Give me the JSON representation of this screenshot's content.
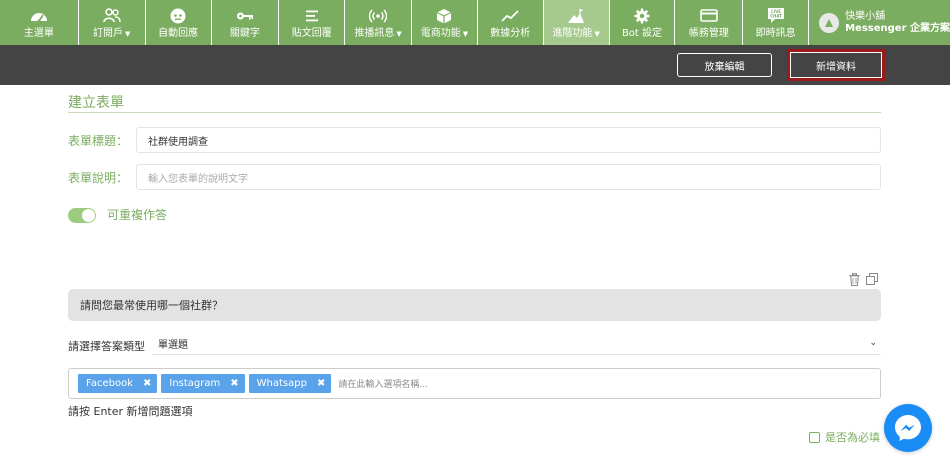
{
  "nav": {
    "items": [
      {
        "label": "主選單",
        "icon": "dashboard-gauge-icon",
        "dropdown": false,
        "active": false
      },
      {
        "label": "訂閱戶",
        "icon": "users-icon",
        "dropdown": true,
        "active": false
      },
      {
        "label": "自動回應",
        "icon": "robot-icon",
        "dropdown": false,
        "active": false
      },
      {
        "label": "關鍵字",
        "icon": "key-icon",
        "dropdown": false,
        "active": false
      },
      {
        "label": "貼文回覆",
        "icon": "reply-icon",
        "dropdown": false,
        "active": false
      },
      {
        "label": "推播訊息",
        "icon": "broadcast-icon",
        "dropdown": true,
        "active": false
      },
      {
        "label": "電商功能",
        "icon": "box-icon",
        "dropdown": true,
        "active": false
      },
      {
        "label": "數據分析",
        "icon": "line-chart-icon",
        "dropdown": false,
        "active": false
      },
      {
        "label": "進階功能",
        "icon": "mountain-flag-icon",
        "dropdown": true,
        "active": true
      },
      {
        "label": "Bot 設定",
        "icon": "gear-icon",
        "dropdown": false,
        "active": false
      },
      {
        "label": "帳務管理",
        "icon": "credit-card-icon",
        "dropdown": false,
        "active": false
      },
      {
        "label": "即時訊息",
        "icon": "live-chat-icon",
        "icon_text": "LIVE CHAT",
        "dropdown": false,
        "active": false
      }
    ],
    "account": {
      "name": "快樂小舖",
      "plan": "Messenger 企業方案"
    }
  },
  "actions": {
    "discard_label": "放棄編輯",
    "add_label": "新增資料"
  },
  "form": {
    "heading": "建立表單",
    "title_label": "表單標題：",
    "title_value": "社群使用調查",
    "desc_label": "表單說明：",
    "desc_placeholder": "輸入您表單的說明文字",
    "repeat_label": "可重複作答",
    "repeat_enabled": true
  },
  "question": {
    "text": "請問您最常使用哪一個社群？",
    "type_label": "請選擇答案類型",
    "type_value": "單選題",
    "options": [
      "Facebook",
      "Instagram",
      "Whatsapp"
    ],
    "option_remove_glyph": "✖",
    "option_placeholder": "請在此輸入選項名稱...",
    "hint": "請按 Enter 新增問題選項",
    "required_label": "是否為必填",
    "required": false
  },
  "colors": {
    "nav_green": "#7aad5f",
    "nav_active": "#a6c98d",
    "action_bar": "#444444",
    "highlight_border": "#9b1b1b",
    "tag_blue": "#5aa3ea",
    "messenger_blue": "#1a8cf5"
  }
}
